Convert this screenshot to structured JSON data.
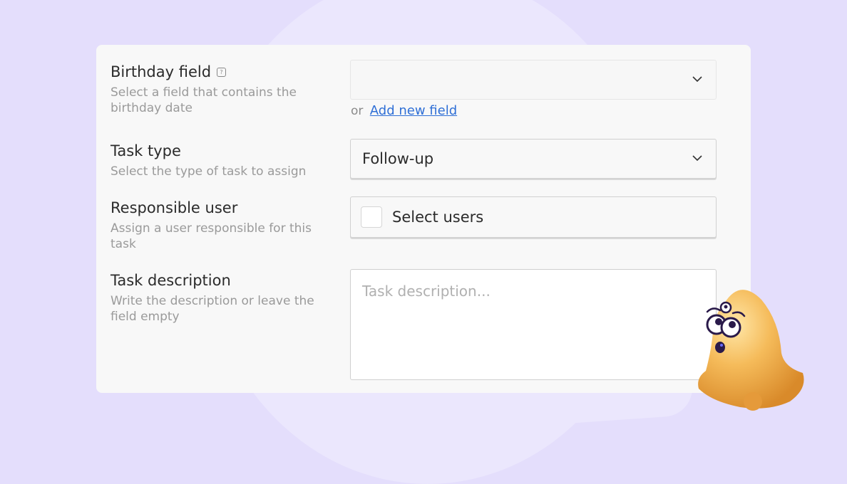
{
  "form": {
    "birthday": {
      "label": "Birthday field",
      "help": "?",
      "description": "Select a field that contains the birthday date",
      "value": "",
      "or_text": "or",
      "add_link": "Add new field"
    },
    "task_type": {
      "label": "Task type",
      "description": "Select the type of task to assign",
      "value": "Follow-up"
    },
    "responsible": {
      "label": "Responsible user",
      "description": "Assign a user responsible for this task",
      "placeholder": "Select users"
    },
    "task_description": {
      "label": "Task description",
      "description": "Write the description or leave the field empty",
      "placeholder": "Task description..."
    }
  },
  "icons": {
    "help": "help-icon",
    "chevron": "chevron-down-icon",
    "mascot": "bell-mascot"
  },
  "colors": {
    "background": "#e4defc",
    "card": "#f8f8f8",
    "link": "#2f6fd6",
    "bell": "#f2b24c"
  }
}
